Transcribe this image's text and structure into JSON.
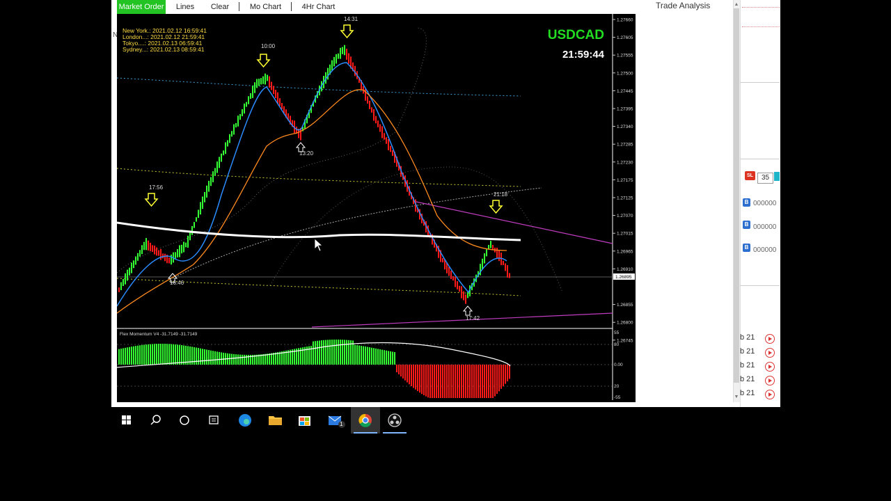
{
  "toolbar": {
    "market_order": "Market Order",
    "lines": "Lines",
    "clear": "Clear",
    "mo_chart": "Mo Chart",
    "hr4_chart": "4Hr Chart"
  },
  "chart": {
    "symbol": "USDCAD",
    "time": "21:59:44",
    "sessions": [
      "New York.: 2021.02.12 16:59:41",
      "London...: 2021.02.12 21:59:41",
      "Tokyo....: 2021.02.13 06:59:41",
      "Sydney...: 2021.02.13 08:59:41"
    ],
    "annotations": {
      "a1": "17:56",
      "a2": "10:00",
      "a3": "14:31",
      "a4": "21:18",
      "b1": "16:46",
      "b2": "13:20",
      "b3": "17:42"
    },
    "price_ticks": [
      "1.27660",
      "1.27605",
      "1.27555",
      "1.27500",
      "1.27445",
      "1.27395",
      "1.27340",
      "1.27285",
      "1.27230",
      "1.27175",
      "1.27125",
      "1.27070",
      "1.27015",
      "1.26965",
      "1.26910",
      "1.26895",
      "1.26855",
      "1.26800",
      "1.26745"
    ],
    "current_price": "1.26895",
    "indicator_title": "Flex Momentum V4 -31.7149 -31.7149",
    "indicator_ticks": [
      "55",
      "80",
      "0.00",
      "20",
      "-55"
    ],
    "colors": {
      "up": "#33ff33",
      "down": "#ff1a1a",
      "accent": "#22c322"
    }
  },
  "panel": {
    "title": "Trade Analysis",
    "sl_label": "SL",
    "sl_value": "35",
    "buys": [
      {
        "badge": "B",
        "value": "000000"
      },
      {
        "badge": "B",
        "value": "000000"
      },
      {
        "badge": "B",
        "value": "000000"
      }
    ],
    "dates": [
      "b 21",
      "b 21",
      "b 21",
      "b 21",
      "b 21"
    ]
  },
  "taskbar": {
    "icons": [
      "windows-start-icon",
      "search-icon",
      "cortana-icon",
      "task-view-icon",
      "edge-icon",
      "file-explorer-icon",
      "store-icon",
      "mail-icon",
      "chrome-icon",
      "obs-icon"
    ],
    "mail_count": "1"
  }
}
